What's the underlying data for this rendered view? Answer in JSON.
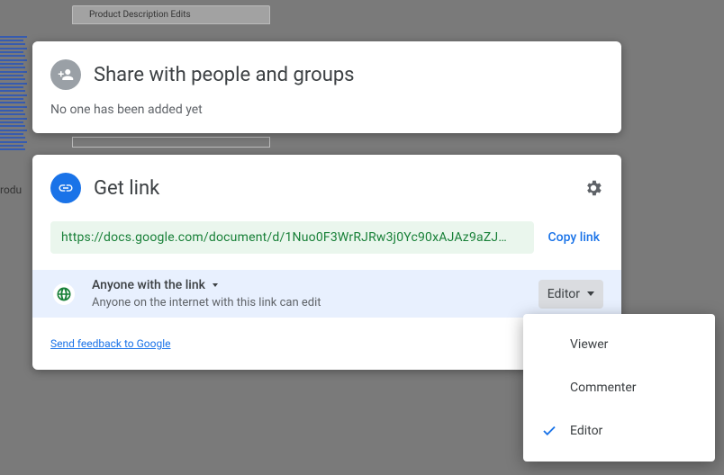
{
  "bg": {
    "tab_label": "Product Description Edits",
    "side_label": "rodu"
  },
  "card1": {
    "title": "Share with people and groups",
    "subtitle": "No one has been added yet"
  },
  "card2": {
    "title": "Get link",
    "url": "https://docs.google.com/document/d/1Nuo0F3WrRJRw3j0Yc90xAJAz9aZJ…",
    "copy_label": "Copy link",
    "scope_label": "Anyone with the link",
    "scope_desc": "Anyone on the internet with this link can edit",
    "role_label": "Editor",
    "feedback": "Send feedback to Google"
  },
  "dropdown": {
    "items": [
      "Viewer",
      "Commenter",
      "Editor"
    ],
    "selected": "Editor"
  }
}
